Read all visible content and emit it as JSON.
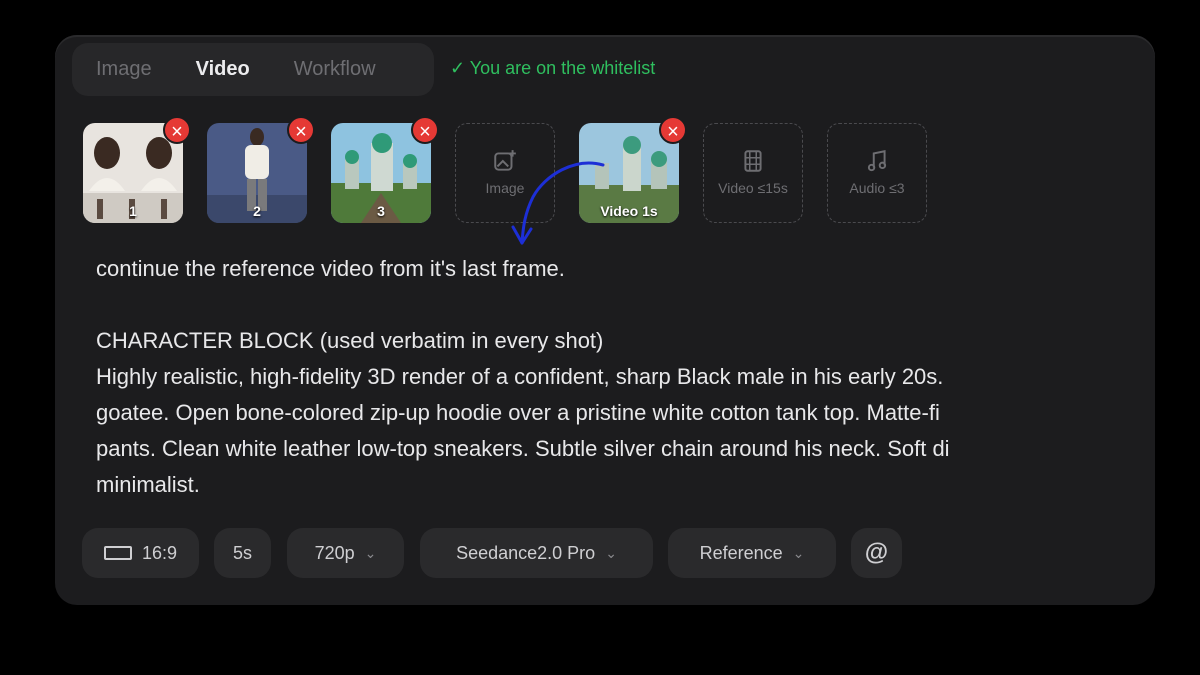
{
  "tabs": [
    "Image",
    "Video",
    "Workflow"
  ],
  "active_tab": "Video",
  "whitelist_status": "✓ You are on the whitelist",
  "references": [
    {
      "caption": "1",
      "kind": "image"
    },
    {
      "caption": "2",
      "kind": "image"
    },
    {
      "caption": "3",
      "kind": "image"
    },
    {
      "caption": "Video 1s",
      "kind": "video"
    }
  ],
  "add_slots": {
    "image": "Image",
    "video": "Video ≤15s",
    "audio": "Audio ≤3"
  },
  "prompt_text": "continue the reference video from it's last frame.\n\nCHARACTER BLOCK (used verbatim in every shot)\nHighly realistic, high-fidelity 3D render of a confident, sharp Black male in his early 20s.\ngoatee. Open bone-colored zip-up hoodie over a pristine white cotton tank top. Matte-fi\npants. Clean white leather low-top sneakers. Subtle silver chain around his neck. Soft di\nminimalist.",
  "toolbar": {
    "aspect": "16:9",
    "duration": "5s",
    "resolution": "720p",
    "model": "Seedance2.0 Pro",
    "mode": "Reference",
    "mention": "@"
  },
  "colors": {
    "accent_green": "#2fbf5f",
    "remove_red": "#e53935",
    "annotation_blue": "#1d2fd6"
  }
}
